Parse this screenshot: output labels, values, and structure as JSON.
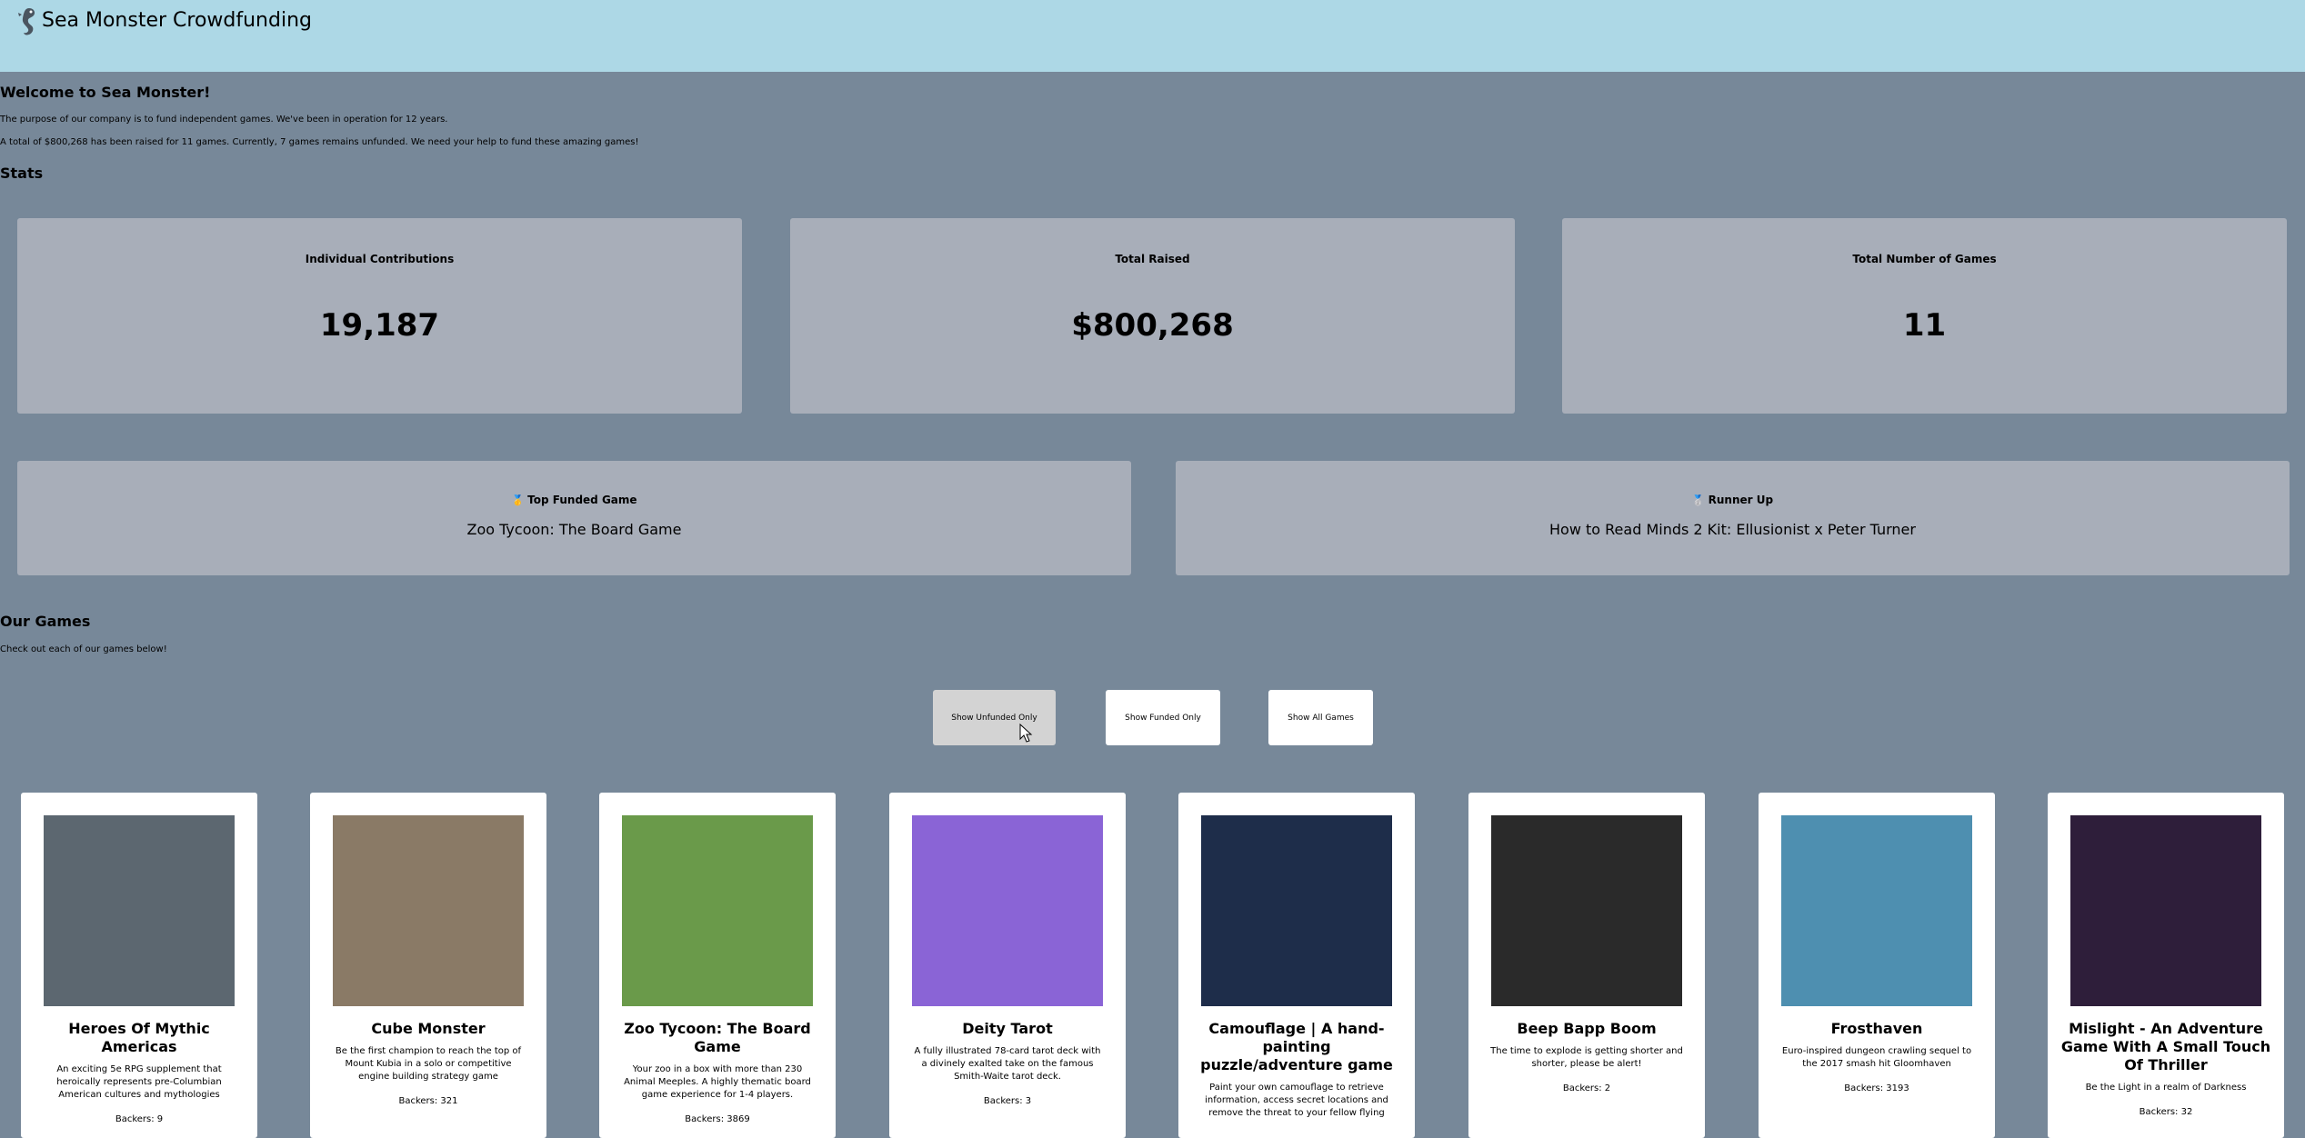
{
  "header": {
    "title": "Sea Monster Crowdfunding",
    "logo_icon": "seahorse-icon"
  },
  "welcome": {
    "heading": "Welcome to Sea Monster!",
    "line1": "The purpose of our company is to fund independent games. We've been in operation for 12 years.",
    "line2": "A total of $800,268 has been raised for 11 games. Currently, 7 games remains unfunded. We need your help to fund these amazing games!"
  },
  "stats": {
    "heading": "Stats",
    "contributions": {
      "label": "Individual Contributions",
      "value": "19,187"
    },
    "raised": {
      "label": "Total Raised",
      "value": "$800,268"
    },
    "num_games": {
      "label": "Total Number of Games",
      "value": "11"
    }
  },
  "top": {
    "first": {
      "medal": "🥇",
      "label": "Top Funded Game",
      "name": "Zoo Tycoon: The Board Game"
    },
    "second": {
      "medal": "🥈",
      "label": "Runner Up",
      "name": "How to Read Minds 2 Kit: Ellusionist x Peter Turner"
    }
  },
  "games_section": {
    "heading": "Our Games",
    "subtitle": "Check out each of our games below!"
  },
  "filters": {
    "unfunded": "Show Unfunded Only",
    "funded": "Show Funded Only",
    "all": "Show All Games"
  },
  "games": [
    {
      "name": "Heroes Of Mythic Americas",
      "desc": "An exciting 5e RPG supplement that heroically represents pre-Columbian American cultures and mythologies",
      "backers": "Backers: 9",
      "color": "#5c6770"
    },
    {
      "name": "Cube Monster",
      "desc": "Be the first champion to reach the top of Mount Kubia in a solo or competitive engine building strategy game",
      "backers": "Backers: 321",
      "color": "#8a7a66"
    },
    {
      "name": "Zoo Tycoon: The Board Game",
      "desc": "Your zoo in a box with more than 230 Animal Meeples. A highly thematic board game experience for 1-4 players.",
      "backers": "Backers: 3869",
      "color": "#6a9a4a"
    },
    {
      "name": "Deity Tarot",
      "desc": "A fully illustrated 78-card tarot deck with a divinely exalted take on the famous Smith-Waite tarot deck.",
      "backers": "Backers: 3",
      "color": "#8a64d6"
    },
    {
      "name": "Camouflage | A hand-painting puzzle/adventure game",
      "desc": "Paint your own camouflage to retrieve information, access secret locations and remove the threat to your fellow flying",
      "backers": "",
      "color": "#1e2d4a"
    },
    {
      "name": "Beep Bapp Boom",
      "desc": "The time to explode is getting shorter and shorter, please be alert!",
      "backers": "Backers: 2",
      "color": "#2a2a2a"
    },
    {
      "name": "Frosthaven",
      "desc": "Euro-inspired dungeon crawling sequel to the 2017 smash hit Gloomhaven",
      "backers": "Backers: 3193",
      "color": "#4e8fb0"
    },
    {
      "name": "Mislight - An Adventure Game With A Small Touch Of Thriller",
      "desc": "Be the Light in a realm of Darkness",
      "backers": "Backers: 32",
      "color": "#2e1e3a"
    }
  ]
}
